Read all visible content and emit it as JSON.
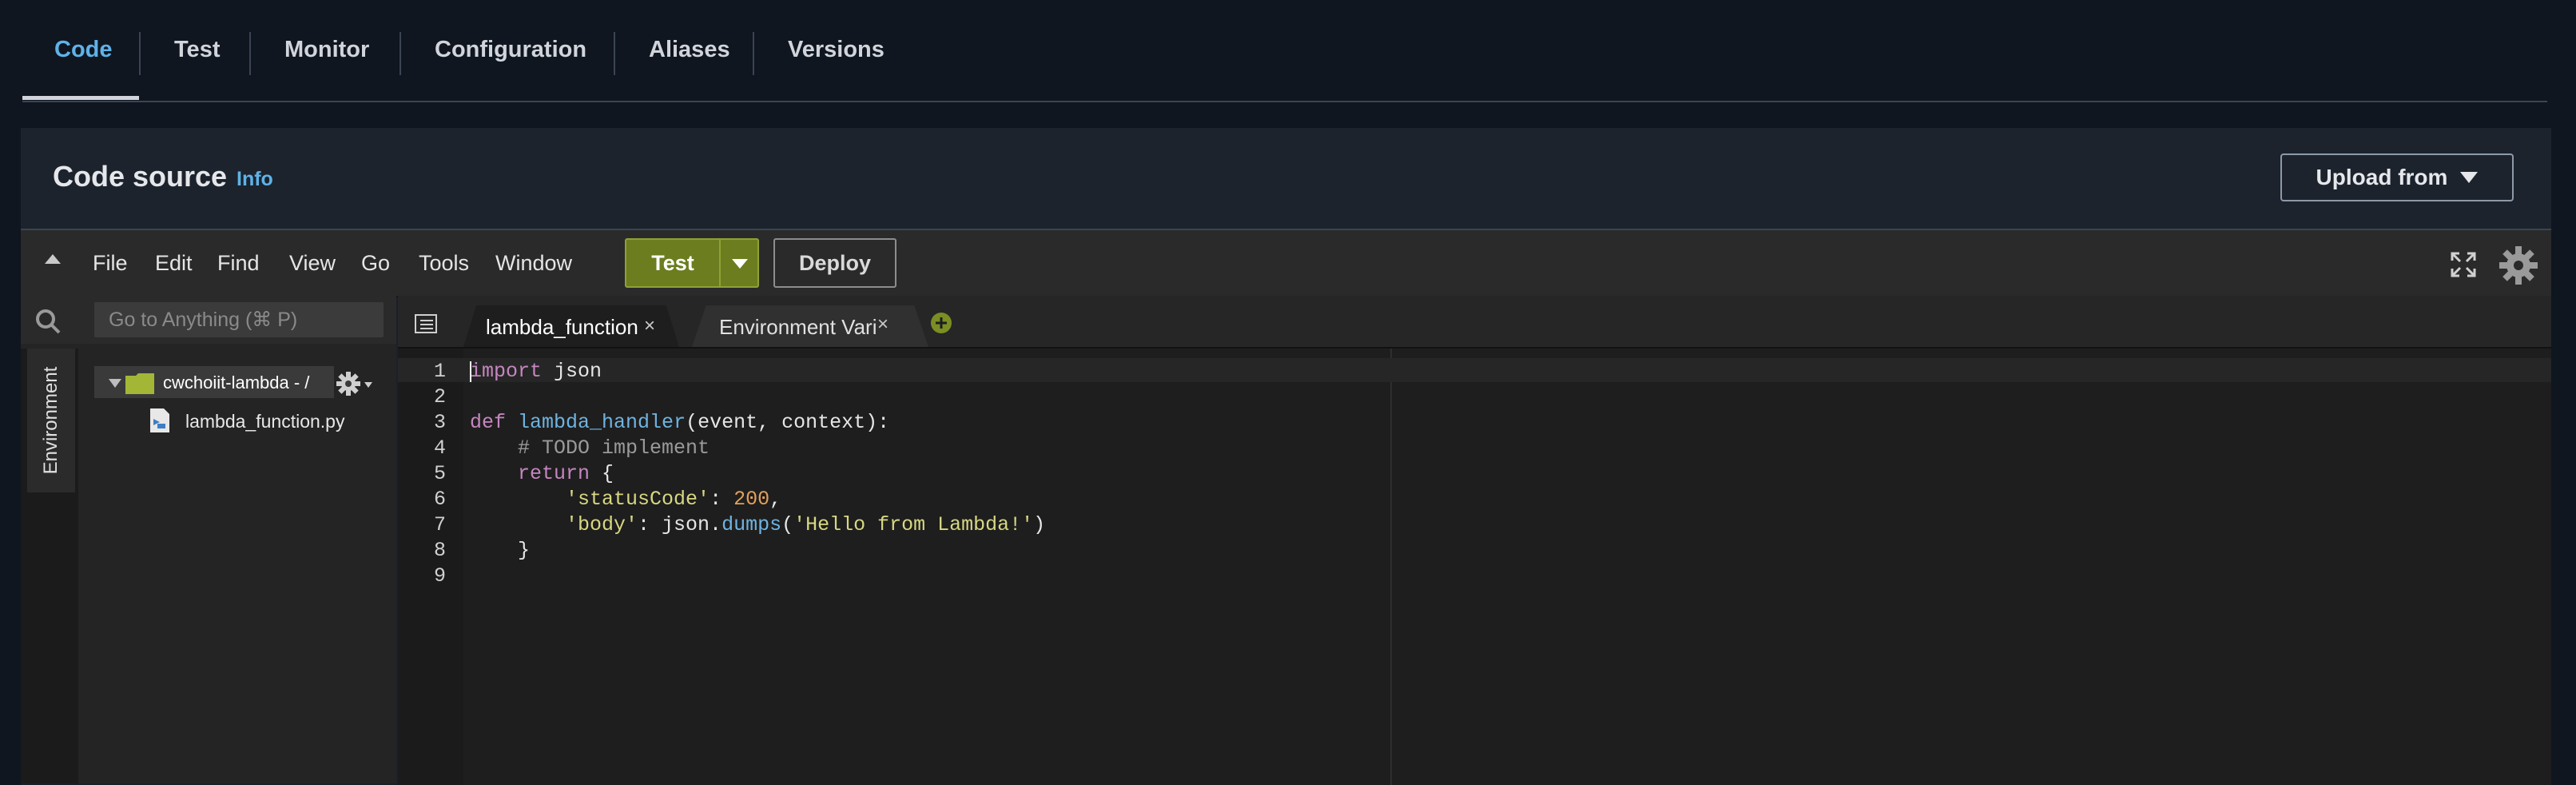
{
  "tabs": [
    {
      "label": "Code"
    },
    {
      "label": "Test"
    },
    {
      "label": "Monitor"
    },
    {
      "label": "Configuration"
    },
    {
      "label": "Aliases"
    },
    {
      "label": "Versions"
    }
  ],
  "code_source": {
    "title": "Code source",
    "info": "Info",
    "upload_label": "Upload from"
  },
  "ide": {
    "menu": [
      "File",
      "Edit",
      "Find",
      "View",
      "Go",
      "Tools",
      "Window"
    ],
    "test_label": "Test",
    "deploy_label": "Deploy",
    "goto_placeholder": "Go to Anything (⌘ P)",
    "environment_label": "Environment",
    "folder_label": "cwchoiit-lambda - /",
    "file_label": "lambda_function.py",
    "editor_tabs": [
      {
        "label": "lambda_function"
      },
      {
        "label": "Environment Vari"
      }
    ],
    "close_glyph": "×",
    "line_numbers": [
      "1",
      "2",
      "3",
      "4",
      "5",
      "6",
      "7",
      "8",
      "9"
    ]
  },
  "code": {
    "l1_kw": "import",
    "l1_rest": " json",
    "l3_kw": "def",
    "l3_fn": "lambda_handler",
    "l3_rest": "(event, context):",
    "l4_comment": "# TODO implement",
    "l5_kw": "return",
    "l5_rest": " {",
    "l6_key": "'statusCode'",
    "l6_sep": ": ",
    "l6_val": "200",
    "l6_end": ",",
    "l7_key": "'body'",
    "l7_sep": ": json.",
    "l7_fn": "dumps",
    "l7_open": "(",
    "l7_val": "'Hello from Lambda!'",
    "l7_close": ")",
    "l8": "}"
  },
  "colors": {
    "accent": "#5fb2e8",
    "test_button": "#6b7d1f",
    "keyword": "#c586c0",
    "function": "#6fb3e0",
    "string": "#d7d782",
    "number": "#e0a15c"
  }
}
